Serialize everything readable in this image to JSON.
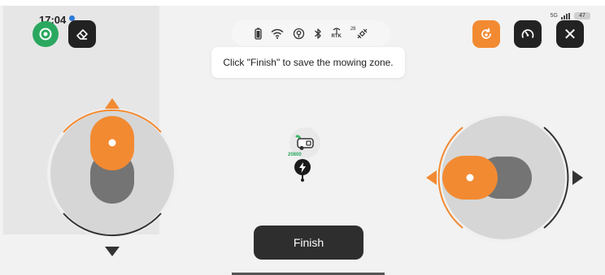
{
  "status_bar": {
    "time": "17:04",
    "network": "5G",
    "battery": "47"
  },
  "top_left": {
    "map_button_icon": "map-target-icon",
    "erase_button_icon": "eraser-icon"
  },
  "device_status": {
    "icons": [
      "battery-icon",
      "wifi-icon",
      "gps-icon",
      "bluetooth-icon",
      "rtk-antenna-icon",
      "satellite-icon"
    ],
    "rtk_label": "RTK",
    "satellite_count": "28"
  },
  "toast": {
    "message": "Click \"Finish\" to save the mowing zone."
  },
  "top_right": {
    "orange_button_icon": "refresh-zone-icon",
    "speed_button_icon": "speedometer-icon",
    "close_button_icon": "close-icon",
    "close_symbol": "✕"
  },
  "map": {
    "robot_label": "20800",
    "robot_icon": "mower-icon",
    "charger_icon": "charging-station-icon"
  },
  "joysticks": {
    "left": {
      "axis": "vertical",
      "knob_level": 1.0
    },
    "right": {
      "axis": "horizontal",
      "knob_level": 0.0
    }
  },
  "finish_button": {
    "label": "Finish"
  },
  "colors": {
    "accent": "#f28a32",
    "green": "#2aa85f",
    "dark": "#222222",
    "joystick_ring": "#d6d6d6"
  }
}
